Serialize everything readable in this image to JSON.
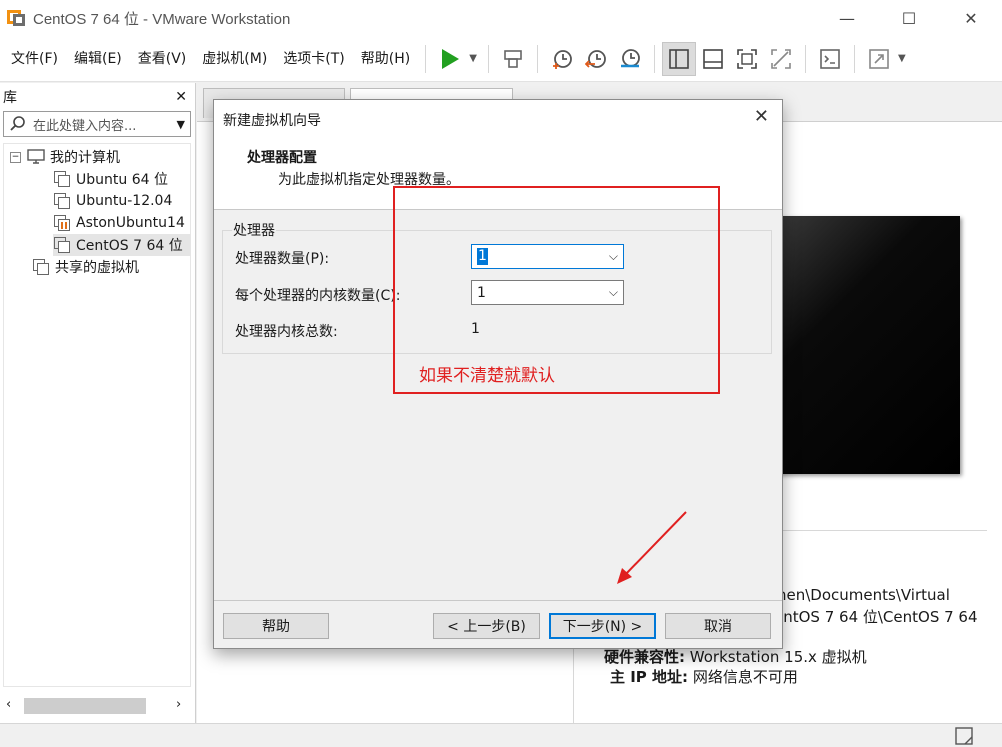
{
  "window": {
    "title": "CentOS 7 64 位 - VMware Workstation",
    "minimize_glyph": "—",
    "maximize_glyph": "☐",
    "close_glyph": "✕"
  },
  "menu": {
    "items": [
      "文件(F)",
      "编辑(E)",
      "查看(V)",
      "虚拟机(M)",
      "选项卡(T)",
      "帮助(H)"
    ]
  },
  "toolbar": {
    "icons": [
      "play-icon",
      "send-keys-icon",
      "snapshot-icon",
      "revert-snapshot-icon",
      "snapshot-manager-icon",
      "show-library-icon",
      "thumbnail-bar-icon",
      "full-screen-icon",
      "unity-icon",
      "console-view-icon",
      "stretch-icon"
    ],
    "accent_play": "#22a020"
  },
  "library": {
    "title": "库",
    "close_glyph": "✕",
    "search_placeholder": "在此处键入内容...",
    "root": "我的计算机",
    "vms": [
      "Ubuntu 64 位",
      "Ubuntu-12.04",
      "AstonUbuntu14",
      "CentOS 7 64 位"
    ],
    "shared": "共享的虚拟机",
    "selected": "CentOS 7 64 位"
  },
  "details": {
    "path_line1": "hen\\Documents\\Virtual",
    "path_line2": "entOS 7 64 位\\CentOS 7 64",
    "compat_key": "硬件兼容性:",
    "compat_val": "Workstation 15.x 虚拟机",
    "ip_key": "主 IP 地址:",
    "ip_val": "网络信息不可用"
  },
  "dialog": {
    "title": "新建虚拟机向导",
    "close_glyph": "✕",
    "heading": "处理器配置",
    "subheading": "为此虚拟机指定处理器数量。",
    "group_label": "处理器",
    "proc_count_label": "处理器数量(P):",
    "proc_count_value": "1",
    "cores_label": "每个处理器的内核数量(C):",
    "cores_value": "1",
    "total_label": "处理器内核总数:",
    "total_value": "1",
    "buttons": {
      "help": "帮助",
      "back": "< 上一步(B)",
      "next": "下一步(N) >",
      "cancel": "取消"
    }
  },
  "annotation": {
    "text": "如果不清楚就默认",
    "color": "#e02020"
  }
}
